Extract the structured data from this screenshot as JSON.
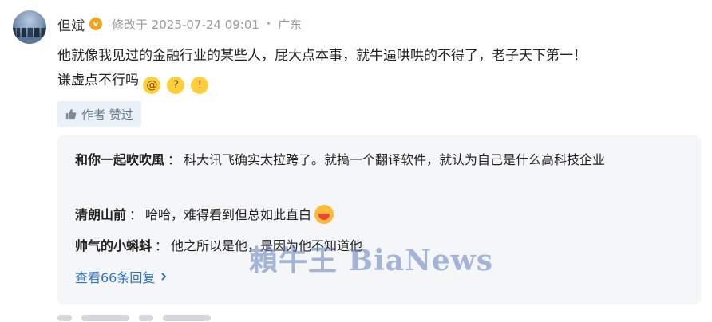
{
  "post": {
    "username": "但斌",
    "verified_badge_text": "v",
    "edited_label": "修改于 2025-07-24 09:01",
    "separator": "•",
    "location": "广东",
    "text_line1": "他就像我见过的金融行业的某些人，屁大点本事，就牛逼哄哄的不得了，老子天下第一！",
    "text_line2": "谦虚点不行吗",
    "emojis": [
      "dizzy-face-emoji",
      "thinking-face-emoji",
      "shushing-face-emoji"
    ]
  },
  "liked_tag": {
    "icon": "thumbs-up-icon",
    "label": "作者 赞过"
  },
  "replies": [
    {
      "name": "和你一起吹吹風",
      "colon": "：",
      "text": "科大讯飞确实太拉跨了。就搞一个翻译软件，就认为自己是什么高科技企业"
    },
    {
      "name": "清朗山前",
      "colon": "：",
      "text": "哈哈，难得看到但总如此直白",
      "emoji": "grinning-face-emoji"
    },
    {
      "name": "帅气的小蝌蚪",
      "colon": "：",
      "text": "他之所以是他，是因为他不知道他"
    }
  ],
  "view_more": "查看66条回复",
  "watermark": "賴牛王 BiaNews",
  "colors": {
    "link": "#2d6fc7",
    "reply_bg": "#f5f6f8",
    "tag_bg": "#eaf1f8",
    "verified": "#f7a21b"
  }
}
